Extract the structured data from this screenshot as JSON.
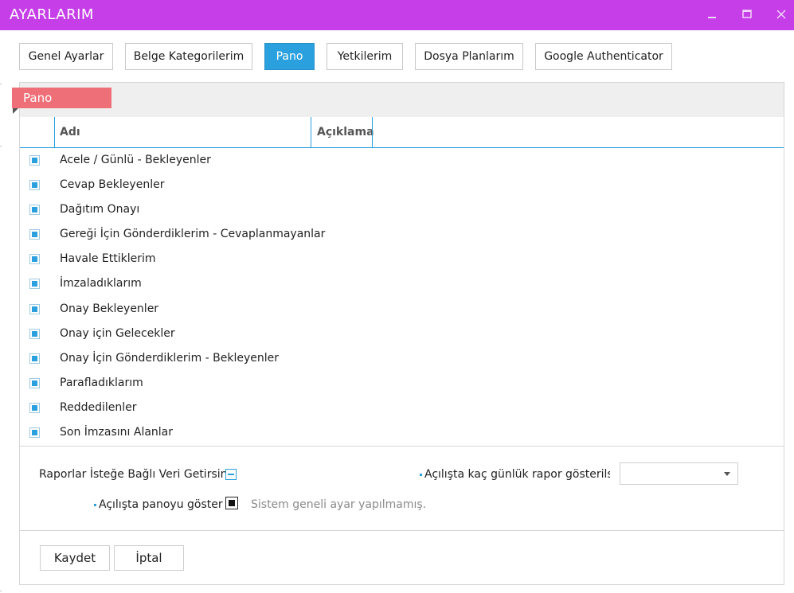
{
  "window": {
    "title": "AYARLARIM",
    "accent_color": "#c53ee8",
    "controls": [
      "minimize-icon",
      "maximize-icon",
      "close-icon"
    ]
  },
  "tabs": [
    {
      "label": "Genel Ayarlar",
      "active": false
    },
    {
      "label": "Belge Kategorilerim",
      "active": false
    },
    {
      "label": "Pano",
      "active": true
    },
    {
      "label": "Yetkilerim",
      "active": false
    },
    {
      "label": "Dosya Planlarım",
      "active": false
    },
    {
      "label": "Google Authenticator",
      "active": false
    }
  ],
  "tab_active_color": "#2aa0de",
  "panel": {
    "tag": "Pano",
    "tag_color": "#ee6f77",
    "columns": [
      "Adı",
      "Açıklama"
    ],
    "items": [
      {
        "name": "Acele / Günlü - Bekleyenler",
        "checked": true
      },
      {
        "name": "Cevap Bekleyenler",
        "checked": true
      },
      {
        "name": "Dağıtım Onayı",
        "checked": true
      },
      {
        "name": "Gereği İçin Gönderdiklerim - Cevaplanmayanlar",
        "checked": true
      },
      {
        "name": "Havale Ettiklerim",
        "checked": true
      },
      {
        "name": "İmzaladıklarım",
        "checked": true
      },
      {
        "name": "Onay Bekleyenler",
        "checked": true
      },
      {
        "name": "Onay için Gelecekler",
        "checked": true
      },
      {
        "name": "Onay İçin Gönderdiklerim - Bekleyenler",
        "checked": true
      },
      {
        "name": "Parafladıklarım",
        "checked": true
      },
      {
        "name": "Reddedilenler",
        "checked": true
      },
      {
        "name": "Son İmzasını Alanlar",
        "checked": true
      }
    ]
  },
  "options": {
    "reports_on_demand_label": "Raporlar İsteğe Bağlı Veri Getirsin",
    "reports_on_demand_state": "indeterminate",
    "report_days_label": "Açılışta kaç günlük rapor gösterilsin",
    "report_days_value": "",
    "show_dashboard_label": "Açılışta panoyu göster",
    "show_dashboard_state": "filled",
    "system_hint": "Sistem geneli ayar yapılmamış."
  },
  "buttons": {
    "save": "Kaydet",
    "cancel": "İptal"
  }
}
